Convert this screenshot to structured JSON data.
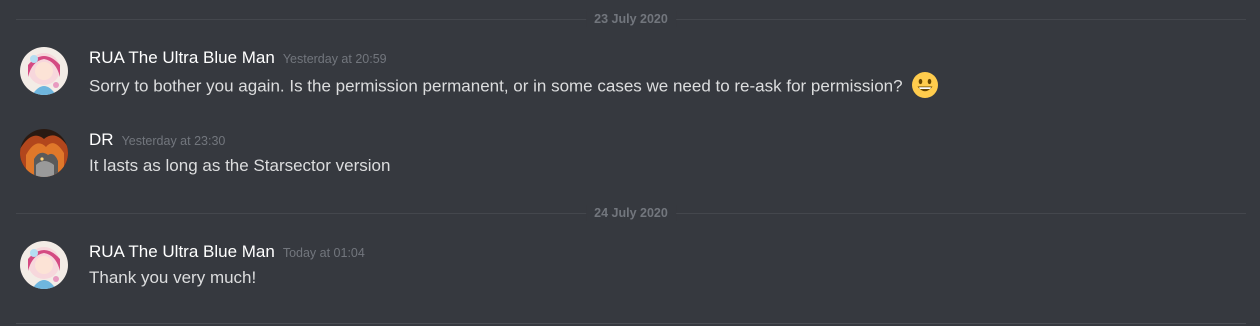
{
  "dividers": [
    {
      "label": "23 July 2020"
    },
    {
      "label": "24 July 2020"
    }
  ],
  "messages": [
    {
      "username": "RUA The Ultra Blue Man",
      "timestamp": "Yesterday at 20:59",
      "text": "Sorry to bother you again. Is the permission permanent, or in some cases we need to re-ask for permission?",
      "emoji": "grinning-face-icon",
      "avatar": "anime-girl-avatar"
    },
    {
      "username": "DR",
      "timestamp": "Yesterday at 23:30",
      "text": "It lasts as long as the Starsector version",
      "avatar": "fiery-creature-avatar"
    },
    {
      "username": "RUA The Ultra Blue Man",
      "timestamp": "Today at 01:04",
      "text": "Thank you very much!",
      "avatar": "anime-girl-avatar"
    }
  ],
  "colors": {
    "background": "#36393f",
    "username": "#ffffff",
    "text": "#dcddde",
    "muted": "#72767d",
    "divider": "#44474d"
  }
}
